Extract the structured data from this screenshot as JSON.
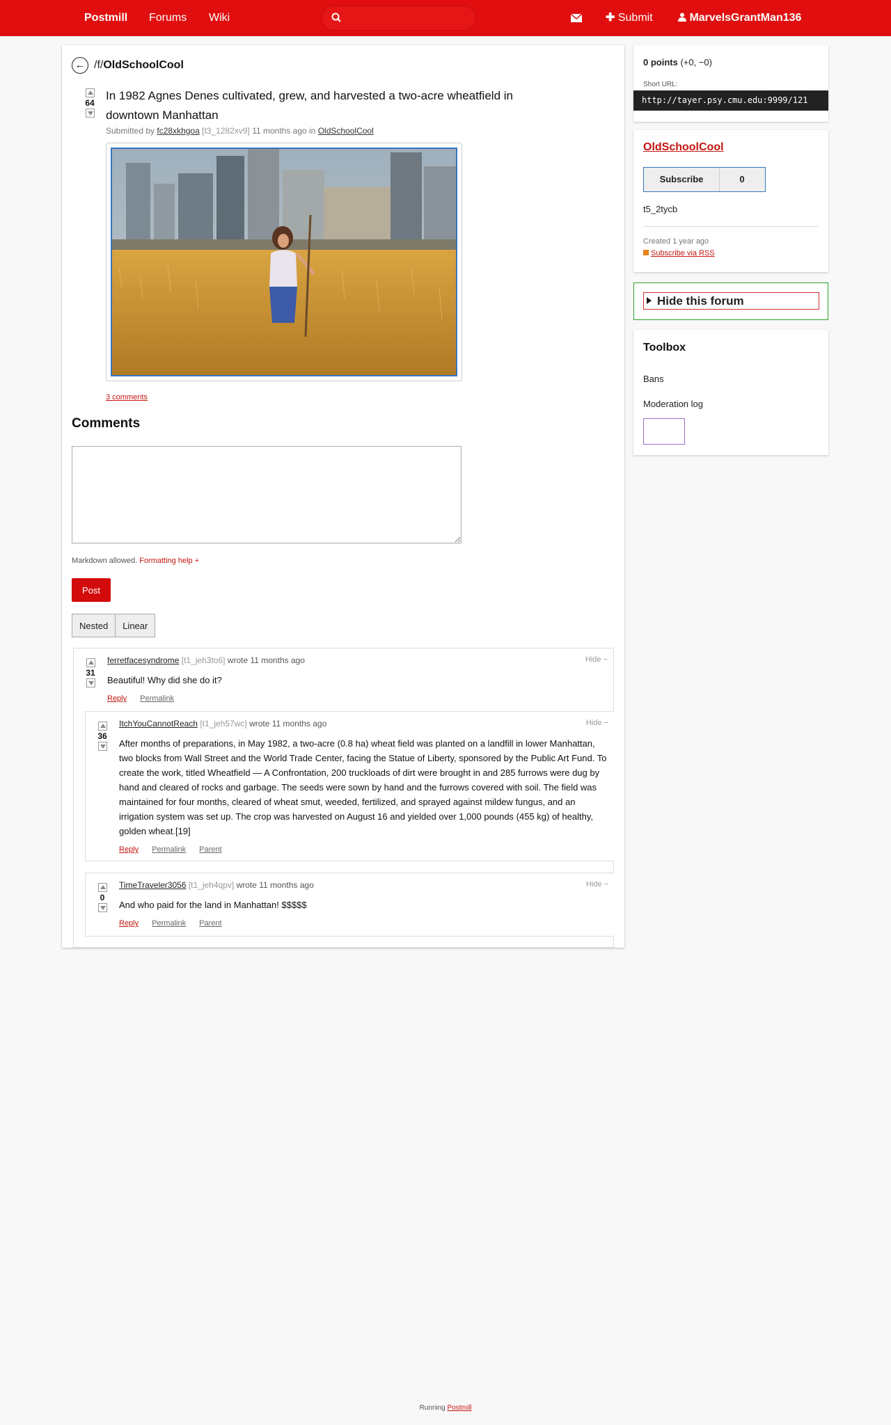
{
  "nav": {
    "brand": "Postmill",
    "forums": "Forums",
    "wiki": "Wiki",
    "search_placeholder": "",
    "submit": "Submit",
    "user": "MarvelsGrantMan136"
  },
  "breadcrumb": {
    "prefix": "/f/",
    "forum": "OldSchoolCool"
  },
  "post": {
    "score": "64",
    "title": "In 1982 Agnes Denes cultivated, grew, and harvested a two-acre wheatfield in downtown Manhattan",
    "submitted_by": "Submitted by",
    "author": "fc28xkhgoa",
    "id": "[t3_1282xv9]",
    "time": "11 months ago in",
    "forum": "OldSchoolCool",
    "comments_link": "3 comments"
  },
  "comments_section": {
    "heading": "Comments",
    "markdown_note": "Markdown allowed.",
    "formatting_help": "Formatting help +",
    "post_button": "Post",
    "view_nested": "Nested",
    "view_linear": "Linear"
  },
  "comments": [
    {
      "author": "ferretfacesyndrome",
      "id": "[t1_jeh3to6]",
      "time": "wrote 11 months ago",
      "hide": "Hide −",
      "score": "31",
      "body": "Beautiful! Why did she do it?",
      "reply": "Reply",
      "permalink": "Permalink"
    },
    {
      "author": "ItchYouCannotReach",
      "id": "[t1_jeh57wc]",
      "time": "wrote 11 months ago",
      "hide": "Hide −",
      "score": "36",
      "body": "After months of preparations, in May 1982, a two-acre (0.8 ha) wheat field was planted on a landfill in lower Manhattan, two blocks from Wall Street and the World Trade Center, facing the Statue of Liberty, sponsored by the Public Art Fund. To create the work, titled Wheatfield — A Confrontation, 200 truckloads of dirt were brought in and 285 furrows were dug by hand and cleared of rocks and garbage. The seeds were sown by hand and the furrows covered with soil. The field was maintained for four months, cleared of wheat smut, weeded, fertilized, and sprayed against mildew fungus, and an irrigation system was set up. The crop was harvested on August 16 and yielded over 1,000 pounds (455 kg) of healthy, golden wheat.[19]",
      "reply": "Reply",
      "permalink": "Permalink",
      "parent": "Parent"
    },
    {
      "author": "TimeTraveler3056",
      "id": "[t1_jeh4qpv]",
      "time": "wrote 11 months ago",
      "hide": "Hide −",
      "score": "0",
      "body": "And who paid for the land in Manhattan! $$$$$",
      "reply": "Reply",
      "permalink": "Permalink",
      "parent": "Parent"
    }
  ],
  "sidebar": {
    "points": "0 points",
    "points_detail": "(+0, −0)",
    "short_url_label": "Short URL:",
    "short_url": "http://tayer.psy.cmu.edu:9999/121",
    "forum_name": "OldSchoolCool",
    "subscribe": "Subscribe",
    "subscriber_count": "0",
    "forum_id": "t5_2tycb",
    "created": "Created 1 year ago",
    "rss": "Subscribe via RSS",
    "hide_forum": "Hide this forum",
    "toolbox_title": "Toolbox",
    "toolbox_links": [
      "Bans",
      "Moderation log"
    ]
  },
  "footer": {
    "running": "Running",
    "app": "Postmill"
  },
  "colors": {
    "brand_red": "#e00e0e",
    "link_red": "#c4160f"
  }
}
